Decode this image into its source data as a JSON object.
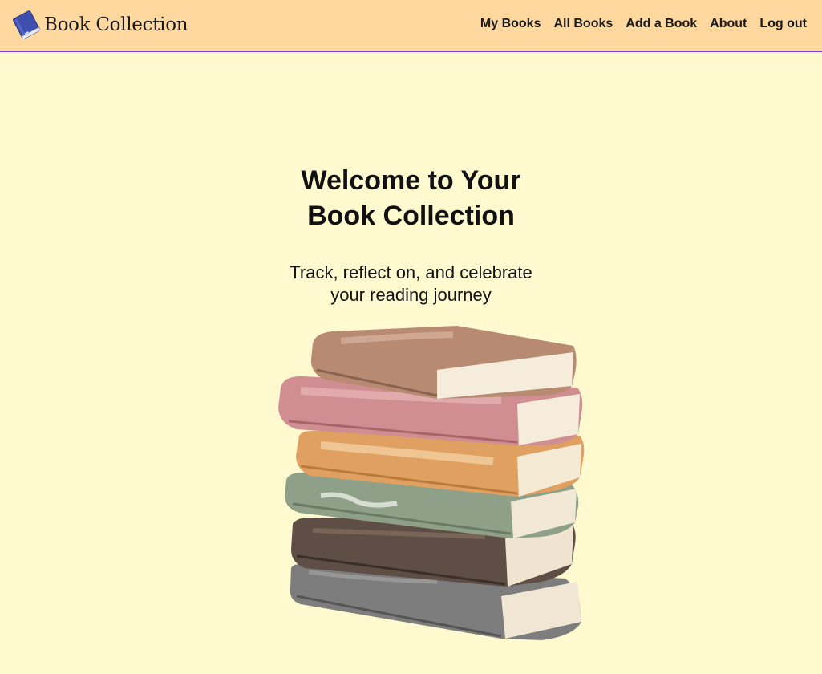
{
  "navbar": {
    "brand": "Book Collection",
    "brand_icon": "book-icon",
    "links": [
      {
        "label": "My Books"
      },
      {
        "label": "All Books"
      },
      {
        "label": "Add a Book"
      },
      {
        "label": "About"
      },
      {
        "label": "Log out"
      }
    ]
  },
  "hero": {
    "title": "Welcome to Your Book Collection",
    "subtitle": "Track, reflect on, and celebrate your reading journey",
    "illustration": "stack-of-books-illustration"
  },
  "colors": {
    "navbar_bg": "#ffd8a0",
    "navbar_border": "#7a3ff0",
    "page_bg": "#fff9d0"
  }
}
